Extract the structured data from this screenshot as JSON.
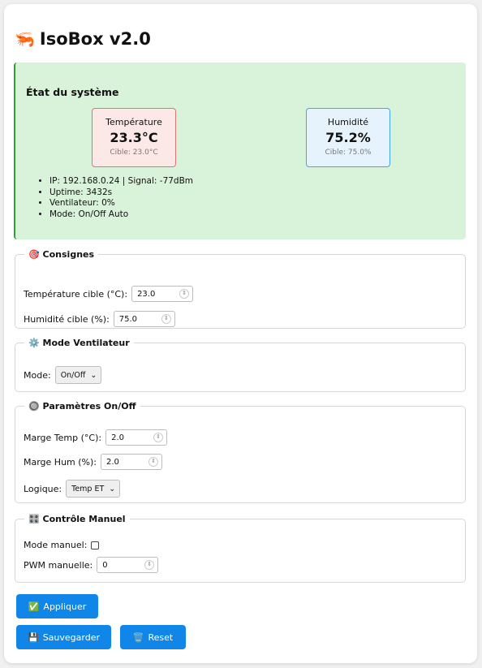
{
  "app": {
    "icon": "shrimp-icon",
    "title": "IsoBox v2.0"
  },
  "status": {
    "heading": "État du système",
    "temperature": {
      "label": "Température",
      "value": "23.3°C",
      "target": "Cible: 23.0°C"
    },
    "humidity": {
      "label": "Humidité",
      "value": "75.2%",
      "target": "Cible: 75.0%"
    },
    "info": [
      "IP: 192.168.0.24 | Signal: -77dBm",
      "Uptime: 3432s",
      "Ventilateur: 0%",
      "Mode: On/Off Auto"
    ]
  },
  "consignes": {
    "icon": "target-icon",
    "legend": "Consignes",
    "temp_label": "Température cible (°C):",
    "temp_value": "23.0",
    "hum_label": "Humidité cible (%):",
    "hum_value": "75.0"
  },
  "ventilateur": {
    "icon": "gear-icon",
    "legend": "Mode Ventilateur",
    "mode_label": "Mode:",
    "mode_value": "On/Off"
  },
  "onoff": {
    "icon": "radio-button-icon",
    "legend": "Paramètres On/Off",
    "temp_margin_label": "Marge Temp (°C):",
    "temp_margin_value": "2.0",
    "hum_margin_label": "Marge Hum (%):",
    "hum_margin_value": "2.0",
    "logic_label": "Logique:",
    "logic_value": "Temp ET"
  },
  "manuel": {
    "icon": "control-knobs-icon",
    "legend": "Contrôle Manuel",
    "mode_label": "Mode manuel:",
    "mode_checked": false,
    "pwm_label": "PWM manuelle:",
    "pwm_value": "0"
  },
  "buttons": {
    "apply": "Appliquer",
    "save": "Sauvegarder",
    "reset": "Reset"
  },
  "colors": {
    "accent": "#1087e8",
    "status_bg": "#d9f2da",
    "status_border": "#2e9d3b",
    "temp_border": "#e57373",
    "hum_border": "#42a5f5"
  }
}
